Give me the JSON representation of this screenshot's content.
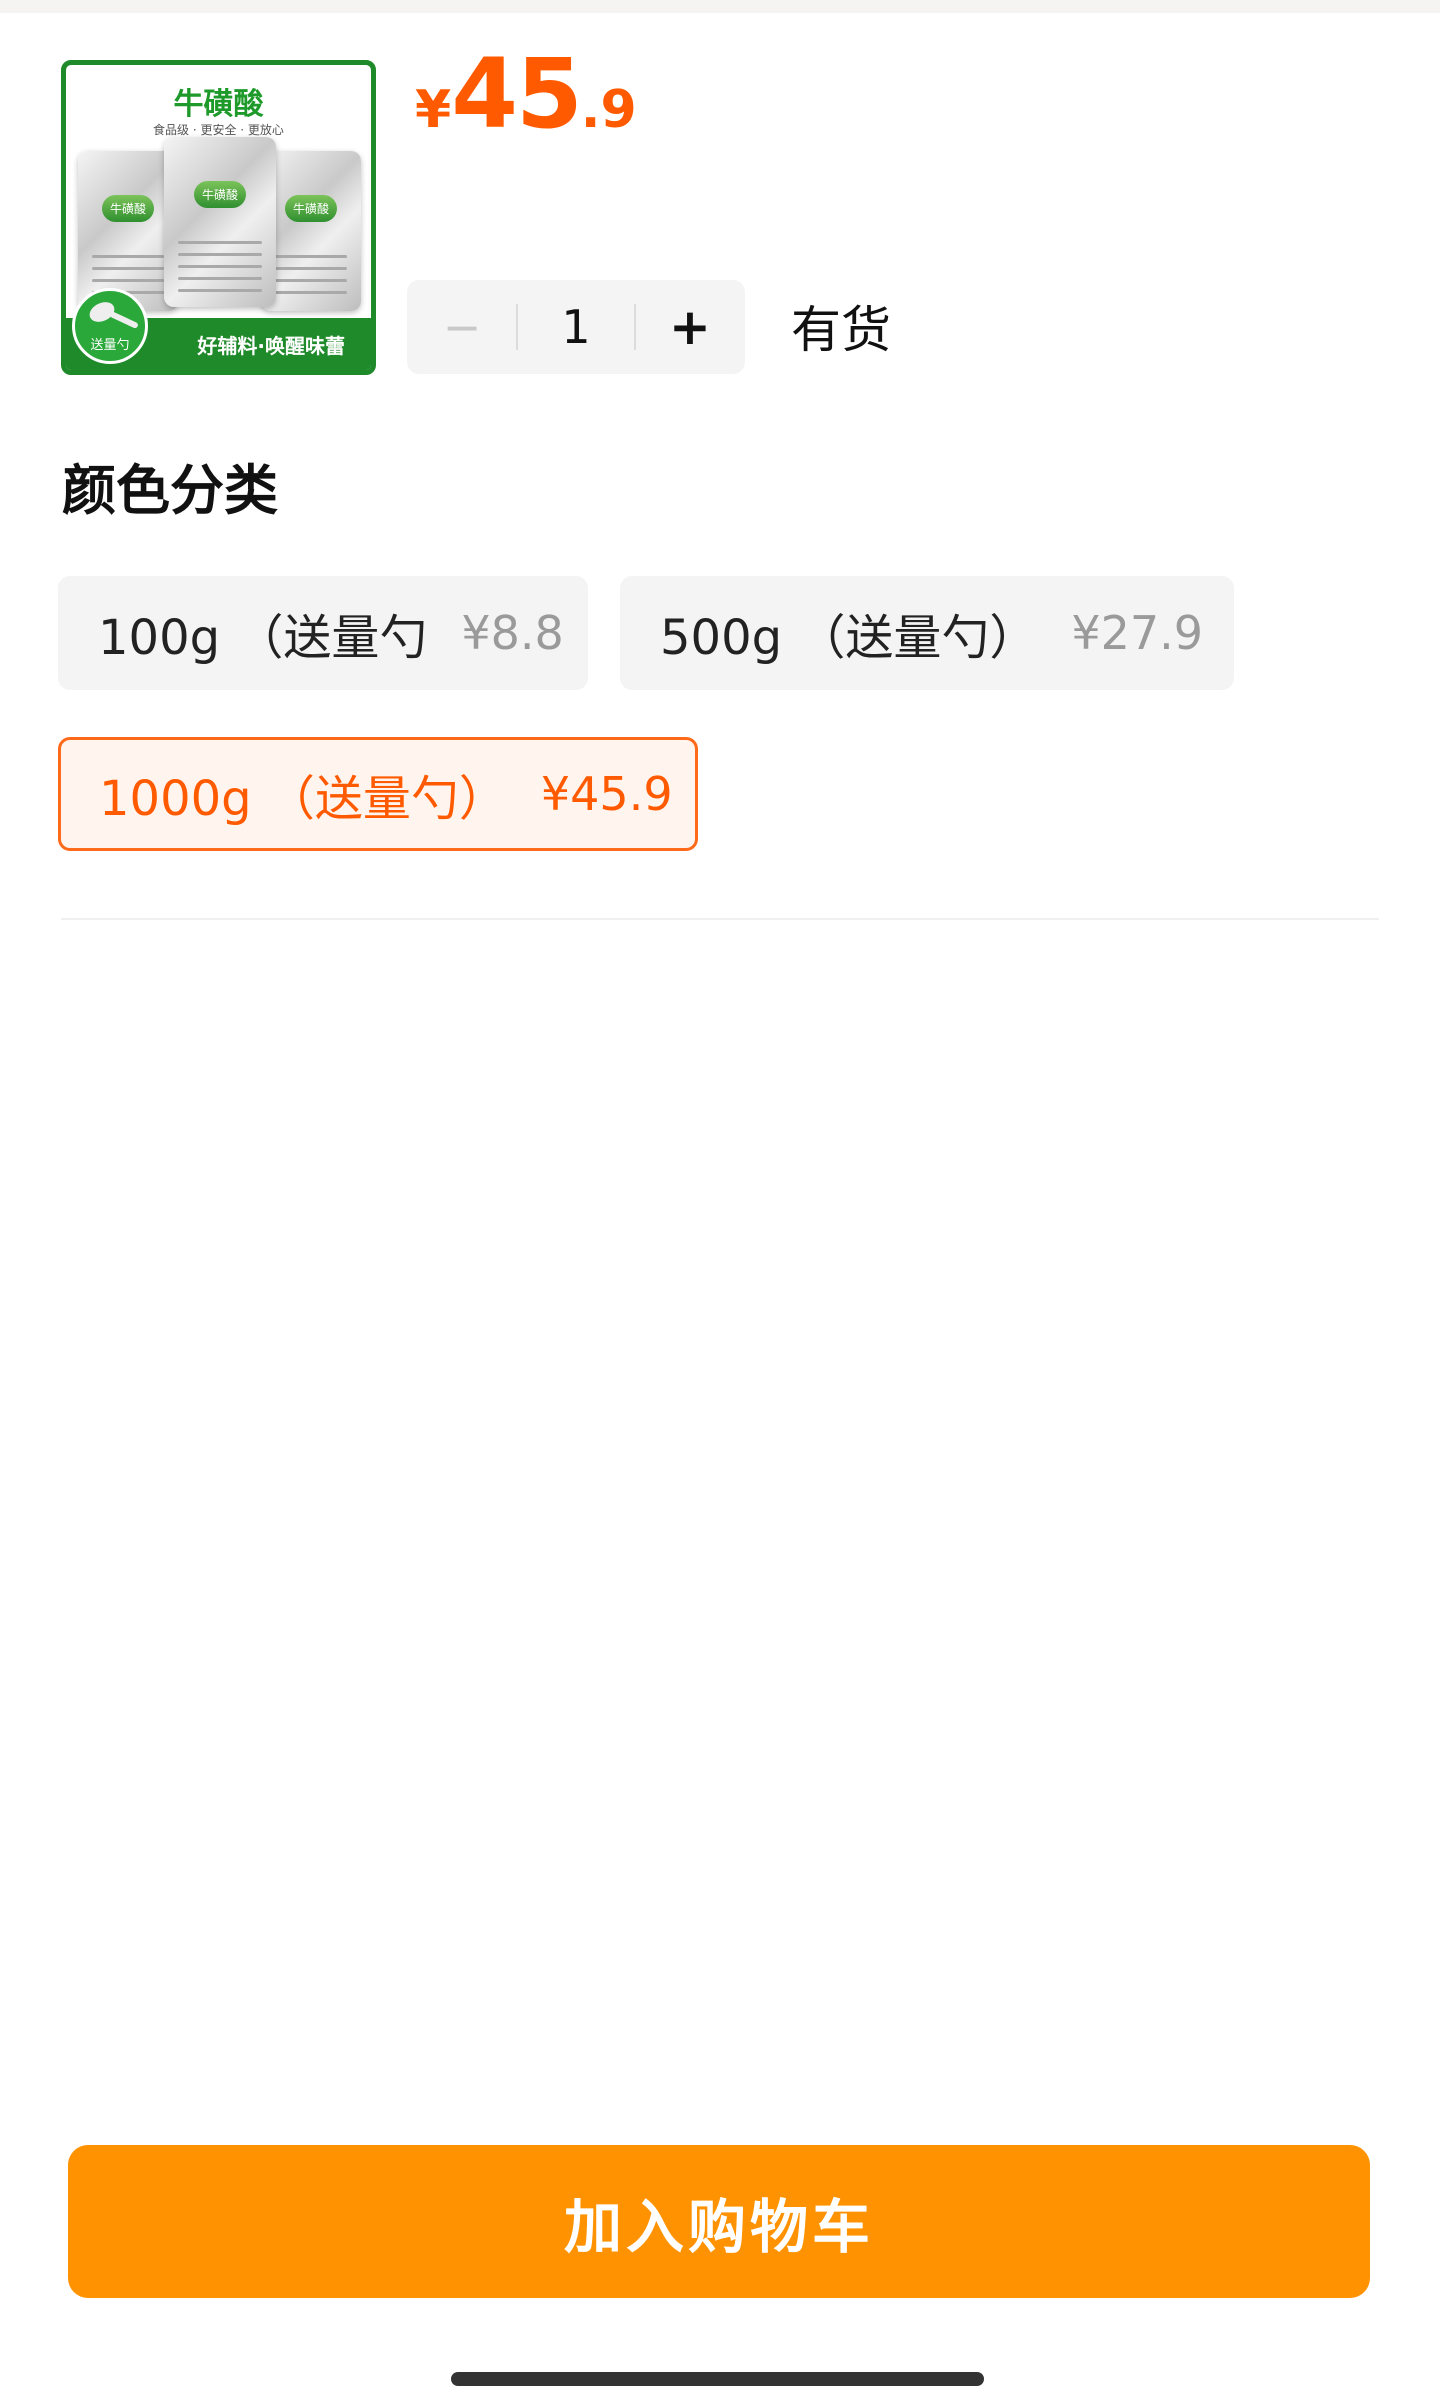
{
  "thumbnail": {
    "title": "牛磺酸",
    "subtitle": "食品级 · 更安全 · 更放心",
    "bag_label": "牛磺酸",
    "badge": "送量勺",
    "ribbon_text": "好辅料·唤醒味蕾",
    "border_color": "#1f8a2a"
  },
  "price": {
    "currency": "¥",
    "integer": "45",
    "decimal": ".9",
    "color": "#ff5a00"
  },
  "quantity": {
    "minus": "−",
    "value": "1",
    "plus": "+"
  },
  "stock_status": "有货",
  "section_title": "颜色分类",
  "options": [
    {
      "label": "100g （送量勺",
      "price": "¥8.8",
      "selected": false
    },
    {
      "label": "500g （送量勺）",
      "price": "¥27.9",
      "selected": false
    },
    {
      "label": "1000g （送量勺）",
      "price": "¥45.9",
      "selected": true
    }
  ],
  "add_to_cart_label": "加入购物车",
  "colors": {
    "accent": "#ff5a00",
    "cart_button": "#ff9200",
    "option_bg": "#f4f4f4"
  }
}
